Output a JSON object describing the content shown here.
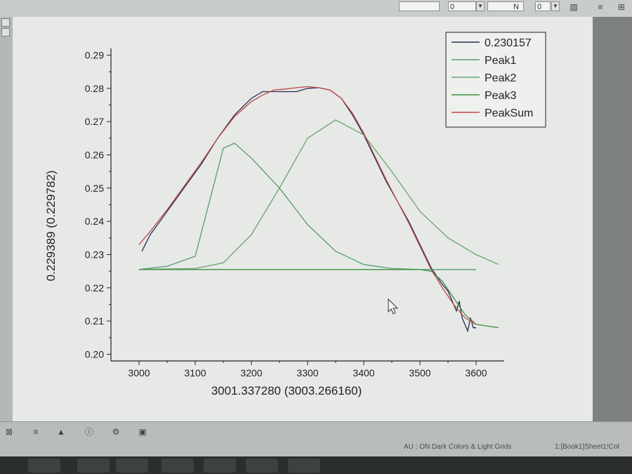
{
  "status_bar": {
    "text": "AU : ON  Dark Colors & Light Grids",
    "sheet": "1:[Book1]Sheet1!Col"
  },
  "toolbar": {
    "font_size_value": "0",
    "bold_label": "N",
    "combo_value": "0"
  },
  "chart_data": {
    "type": "line",
    "xlabel": "3001.337280 (3003.266160)",
    "ylabel": "0.229389 (0.229782)",
    "xlim": [
      2950,
      3650
    ],
    "ylim": [
      0.198,
      0.292
    ],
    "x_ticks": [
      3000,
      3100,
      3200,
      3300,
      3400,
      3500,
      3600
    ],
    "x_tick_labels": [
      "3000",
      "3100",
      "3200",
      "3300",
      "3400",
      "3500",
      "3600"
    ],
    "y_ticks": [
      0.2,
      0.21,
      0.22,
      0.23,
      0.24,
      0.25,
      0.26,
      0.27,
      0.28,
      0.29
    ],
    "y_tick_labels": [
      "0.20",
      "0.21",
      "0.22",
      "0.23",
      "0.24",
      "0.25",
      "0.26",
      "0.27",
      "0.28",
      "0.29"
    ],
    "grid": false,
    "legend_position": "top-right",
    "series": [
      {
        "name": "0.230157",
        "color": "#2a2c55",
        "x": [
          3005,
          3020,
          3050,
          3080,
          3110,
          3140,
          3170,
          3200,
          3220,
          3240,
          3260,
          3280,
          3300,
          3320,
          3340,
          3360,
          3380,
          3400,
          3420,
          3440,
          3460,
          3480,
          3500,
          3520,
          3540,
          3550,
          3560,
          3565,
          3570,
          3575,
          3580,
          3585,
          3590,
          3595,
          3600
        ],
        "y": [
          0.231,
          0.236,
          0.243,
          0.25,
          0.257,
          0.265,
          0.272,
          0.277,
          0.279,
          0.279,
          0.279,
          0.279,
          0.28,
          0.2802,
          0.2795,
          0.277,
          0.272,
          0.266,
          0.259,
          0.252,
          0.246,
          0.24,
          0.233,
          0.226,
          0.221,
          0.219,
          0.215,
          0.213,
          0.216,
          0.211,
          0.209,
          0.207,
          0.211,
          0.208,
          0.208
        ]
      },
      {
        "name": "Peak1",
        "color": "#5a9a74",
        "x": [
          3000,
          3050,
          3100,
          3150,
          3170,
          3200,
          3250,
          3300,
          3350,
          3400,
          3450,
          3500,
          3550,
          3600
        ],
        "y": [
          0.2255,
          0.2265,
          0.2295,
          0.262,
          0.2635,
          0.259,
          0.25,
          0.239,
          0.231,
          0.227,
          0.2258,
          0.2255,
          0.2255,
          0.2255
        ]
      },
      {
        "name": "Peak2",
        "color": "#6aa36c",
        "x": [
          3000,
          3100,
          3150,
          3200,
          3250,
          3300,
          3350,
          3400,
          3450,
          3500,
          3550,
          3600,
          3640
        ],
        "y": [
          0.2255,
          0.2258,
          0.2275,
          0.236,
          0.25,
          0.265,
          0.2705,
          0.266,
          0.255,
          0.243,
          0.235,
          0.23,
          0.227
        ]
      },
      {
        "name": "Peak3",
        "color": "#3f8f3f",
        "x": [
          3000,
          3200,
          3400,
          3500,
          3520,
          3540,
          3560,
          3580,
          3600,
          3640
        ],
        "y": [
          0.2255,
          0.2255,
          0.2255,
          0.2255,
          0.225,
          0.222,
          0.217,
          0.212,
          0.209,
          0.208
        ]
      },
      {
        "name": "PeakSum",
        "color": "#c04848",
        "x": [
          3000,
          3020,
          3050,
          3080,
          3110,
          3140,
          3170,
          3200,
          3220,
          3240,
          3260,
          3280,
          3300,
          3320,
          3340,
          3360,
          3380,
          3400,
          3420,
          3440,
          3460,
          3480,
          3500,
          3520,
          3540,
          3560,
          3580,
          3600
        ],
        "y": [
          0.233,
          0.237,
          0.2435,
          0.2505,
          0.2575,
          0.265,
          0.2715,
          0.276,
          0.278,
          0.2795,
          0.2798,
          0.2802,
          0.2805,
          0.2802,
          0.2795,
          0.277,
          0.2725,
          0.2665,
          0.2595,
          0.2525,
          0.246,
          0.2395,
          0.2325,
          0.2255,
          0.22,
          0.215,
          0.211,
          0.209
        ]
      }
    ]
  }
}
